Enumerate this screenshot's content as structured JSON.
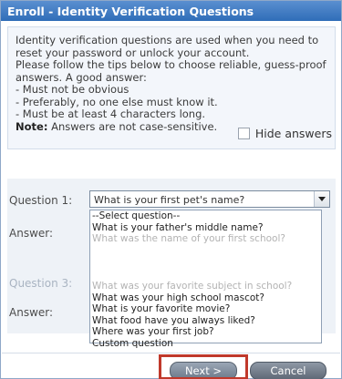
{
  "window": {
    "title": "Enroll - Identity Verification Questions"
  },
  "info": {
    "lines": [
      "Identity verification questions are used when you need to",
      "reset your password or unlock your account.",
      "Please follow the tips below to choose reliable, guess-proof",
      "answers. A good answer:",
      " - Must not be obvious",
      " - Preferably, no one else must know it.",
      " - Must be at least 4 characters long."
    ],
    "note_label": "Note:",
    "note_text": " Answers are not case-sensitive."
  },
  "hide_answers": {
    "label": "Hide answers",
    "checked": false
  },
  "questions": {
    "q1_label": "Question 1:",
    "q1_selected": "What is your first pet's name?",
    "answer1_label": "Answer:",
    "q3_label": "Question 3:",
    "answer3_label": "Answer:"
  },
  "dropdown": {
    "options_top": [
      "--Select question--",
      "What is your father's middle name?",
      "What was the name of your first school?"
    ],
    "faded_option": "What was your favorite subject in school?",
    "options_bottom": [
      "What was your high school mascot?",
      "What is your favorite movie?",
      "What food have you always liked?",
      "Where was your first job?",
      "Custom question"
    ]
  },
  "buttons": {
    "next": "Next >",
    "cancel": "Cancel"
  },
  "colors": {
    "title_bar": "#2f6db8",
    "highlight": "#c0392b"
  },
  "icons": {
    "dropdown": "chevron-down-icon"
  }
}
